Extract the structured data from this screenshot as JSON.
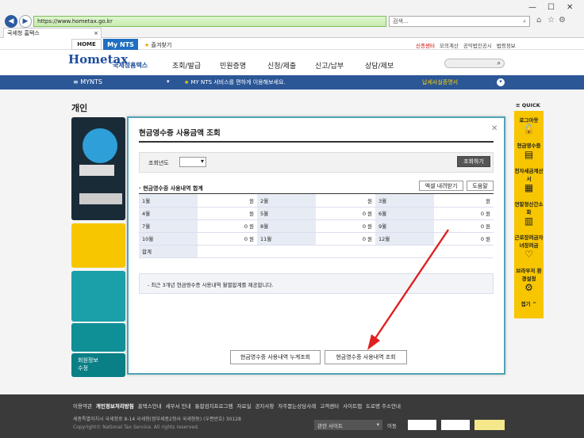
{
  "browser": {
    "url": "https://www.hometax.go.kr",
    "search_placeholder": "검색...",
    "tab_title": "국세청 홈택스"
  },
  "site": {
    "home_tab": "HOME",
    "mynts_tab": "My NTS",
    "favorites": "즐겨찾기",
    "top_links": [
      "신종센터",
      "모의계산",
      "공익법인공시",
      "법령정보"
    ],
    "logo": "Hometax",
    "logo_sub": "국세청홈택스",
    "menu": [
      "조회/발급",
      "민원증명",
      "신청/제출",
      "신고/납부",
      "상담/제보"
    ],
    "nav_mynts": "MYNTS",
    "nav_message": "MY NTS 서비스를 편하게 이용해보세요.",
    "nav_notice": "납세사실증명서"
  },
  "page": {
    "title": "개인",
    "sidebar_bottom": "회원정보\n수정"
  },
  "quick": {
    "label": "QUICK",
    "items": [
      "로그아웃",
      "현금영수증",
      "전자세금계산서",
      "연말정산간소화",
      "근로장려금자녀장려금",
      "브라우저 환경설정"
    ],
    "collapse": "접기"
  },
  "modal": {
    "title": "현금영수증 사용금액 조회",
    "year_label": "조회년도",
    "search_button": "조회하기",
    "section_title": "현금영수증 사용내역 합계",
    "excel_button": "엑셀 내려받기",
    "help_button": "도움말",
    "months": [
      [
        "1월",
        "원",
        "2월",
        "원",
        "3월",
        "원"
      ],
      [
        "4월",
        "원",
        "5월",
        "0 원",
        "6월",
        "0 원"
      ],
      [
        "7월",
        "0 원",
        "8월",
        "0 원",
        "9월",
        "0 원"
      ],
      [
        "10월",
        "0 원",
        "11월",
        "0 원",
        "12월",
        "0 원"
      ]
    ],
    "total_label": "합계",
    "note": "최근 3개년 현금영수증 사용내역 월별합계를 제공합니다.",
    "btn_cumulative": "현금영수증 사용내역 누계조회",
    "btn_detail": "현금영수증 사용내역 조회"
  },
  "footer": {
    "links": [
      "이용약관",
      "개인정보처리방침",
      "홈택스안내",
      "세무서 안내",
      "통합검지프로그램",
      "자료실",
      "공지사항",
      "자주묻는상담사례",
      "고객센터",
      "사이트맵",
      "도로명 주소안내"
    ],
    "address": "세종특별자치시 국세청로 8-14 국세청(정부세종2청사 국세청동) (우편번호) 30128",
    "copyright": "Copyright© National Tax Service. All rights reserved.",
    "related_sites": "관련 사이트",
    "go": "이동"
  },
  "colors": {
    "primary": "#2b5797",
    "accent": "#1f6fc2",
    "quick_bg": "#f7c600",
    "modal_border": "#4fa3b7",
    "arrow": "#e02020"
  }
}
